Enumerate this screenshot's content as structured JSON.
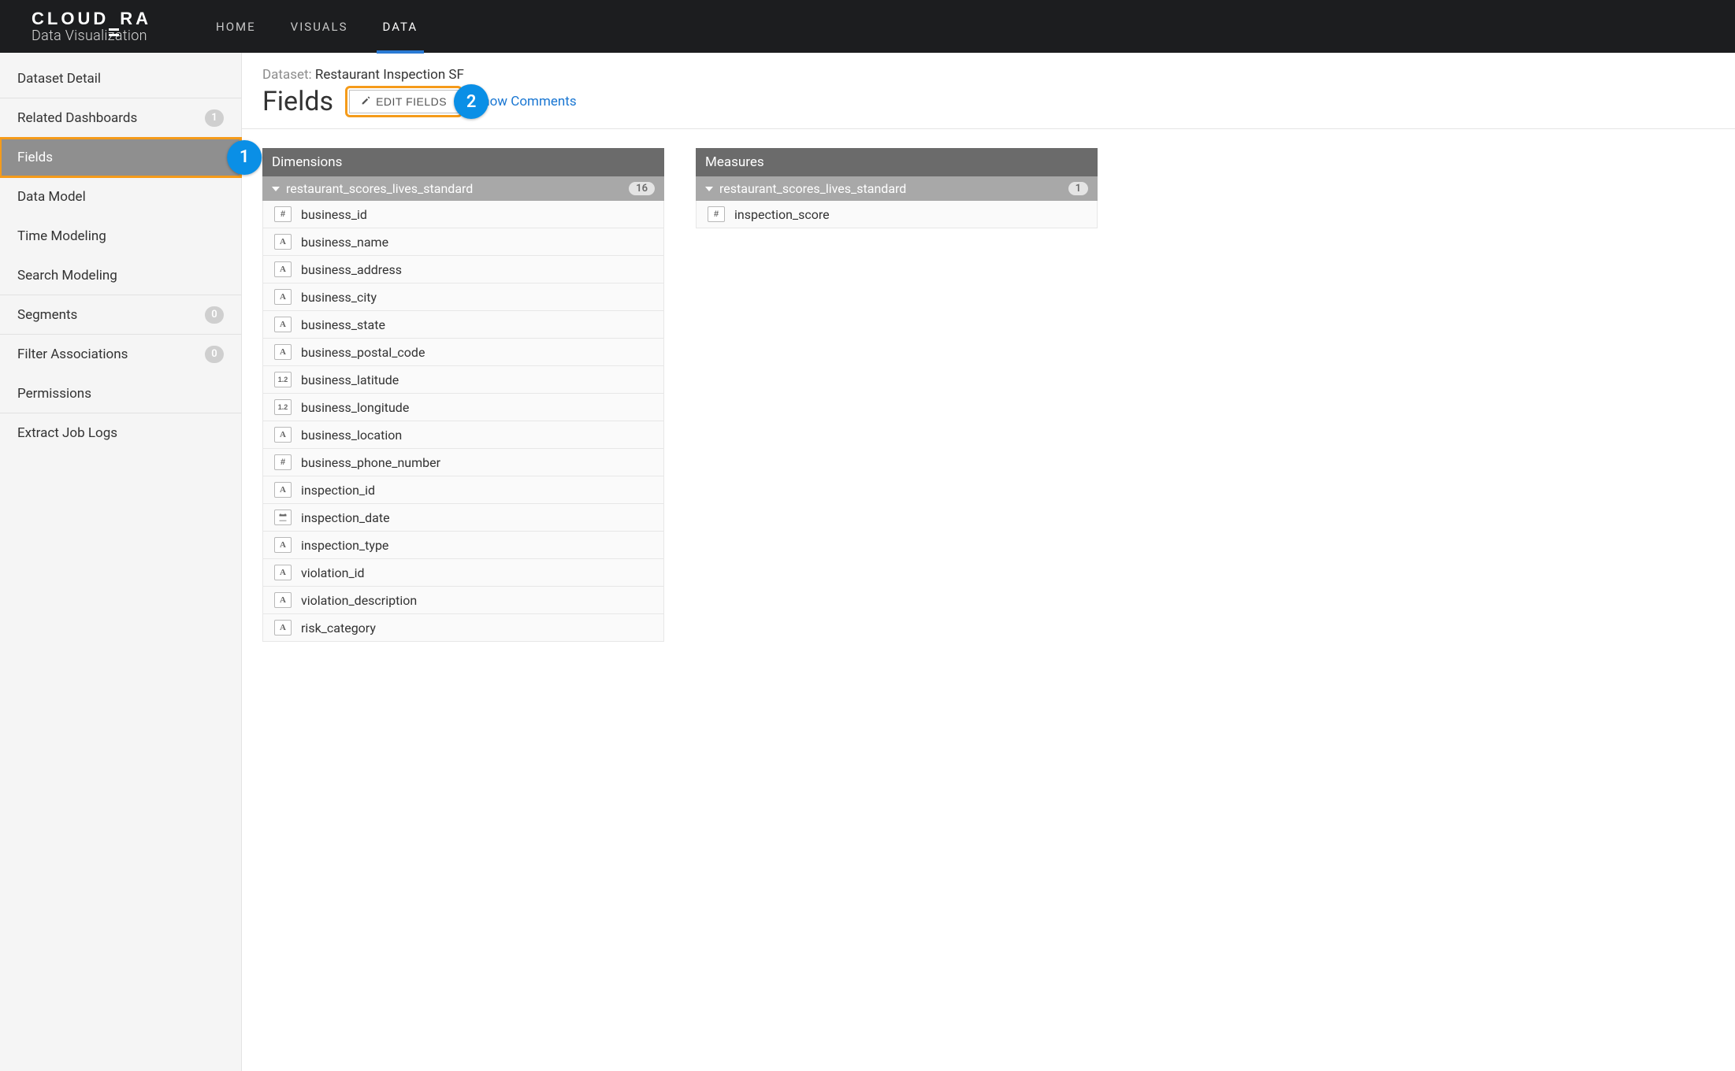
{
  "brand": {
    "name": "CLOUDERA",
    "sub": "Data Visualization"
  },
  "nav": {
    "home": "HOME",
    "visuals": "VISUALS",
    "data": "DATA"
  },
  "sidebar": {
    "items": [
      {
        "label": "Dataset Detail"
      },
      {
        "label": "Related Dashboards",
        "badge": "1"
      },
      {
        "label": "Fields"
      },
      {
        "label": "Data Model"
      },
      {
        "label": "Time Modeling"
      },
      {
        "label": "Search Modeling"
      },
      {
        "label": "Segments",
        "badge": "0"
      },
      {
        "label": "Filter Associations",
        "badge": "0"
      },
      {
        "label": "Permissions"
      },
      {
        "label": "Extract Job Logs"
      }
    ]
  },
  "callouts": {
    "one": "1",
    "two": "2"
  },
  "header": {
    "dataset_prefix": "Dataset: ",
    "dataset_name": "Restaurant Inspection SF",
    "title": "Fields",
    "edit_btn": "EDIT FIELDS",
    "show_comments": "Show Comments"
  },
  "dimensions": {
    "title": "Dimensions",
    "group": "restaurant_scores_lives_standard",
    "count": "16",
    "fields": [
      {
        "type": "#",
        "name": "business_id"
      },
      {
        "type": "A",
        "name": "business_name"
      },
      {
        "type": "A",
        "name": "business_address"
      },
      {
        "type": "A",
        "name": "business_city"
      },
      {
        "type": "A",
        "name": "business_state"
      },
      {
        "type": "A",
        "name": "business_postal_code"
      },
      {
        "type": "1.2",
        "name": "business_latitude"
      },
      {
        "type": "1.2",
        "name": "business_longitude"
      },
      {
        "type": "A",
        "name": "business_location"
      },
      {
        "type": "#",
        "name": "business_phone_number"
      },
      {
        "type": "A",
        "name": "inspection_id"
      },
      {
        "type": "cal",
        "name": "inspection_date"
      },
      {
        "type": "A",
        "name": "inspection_type"
      },
      {
        "type": "A",
        "name": "violation_id"
      },
      {
        "type": "A",
        "name": "violation_description"
      },
      {
        "type": "A",
        "name": "risk_category"
      }
    ]
  },
  "measures": {
    "title": "Measures",
    "group": "restaurant_scores_lives_standard",
    "count": "1",
    "fields": [
      {
        "type": "#",
        "name": "inspection_score"
      }
    ]
  }
}
